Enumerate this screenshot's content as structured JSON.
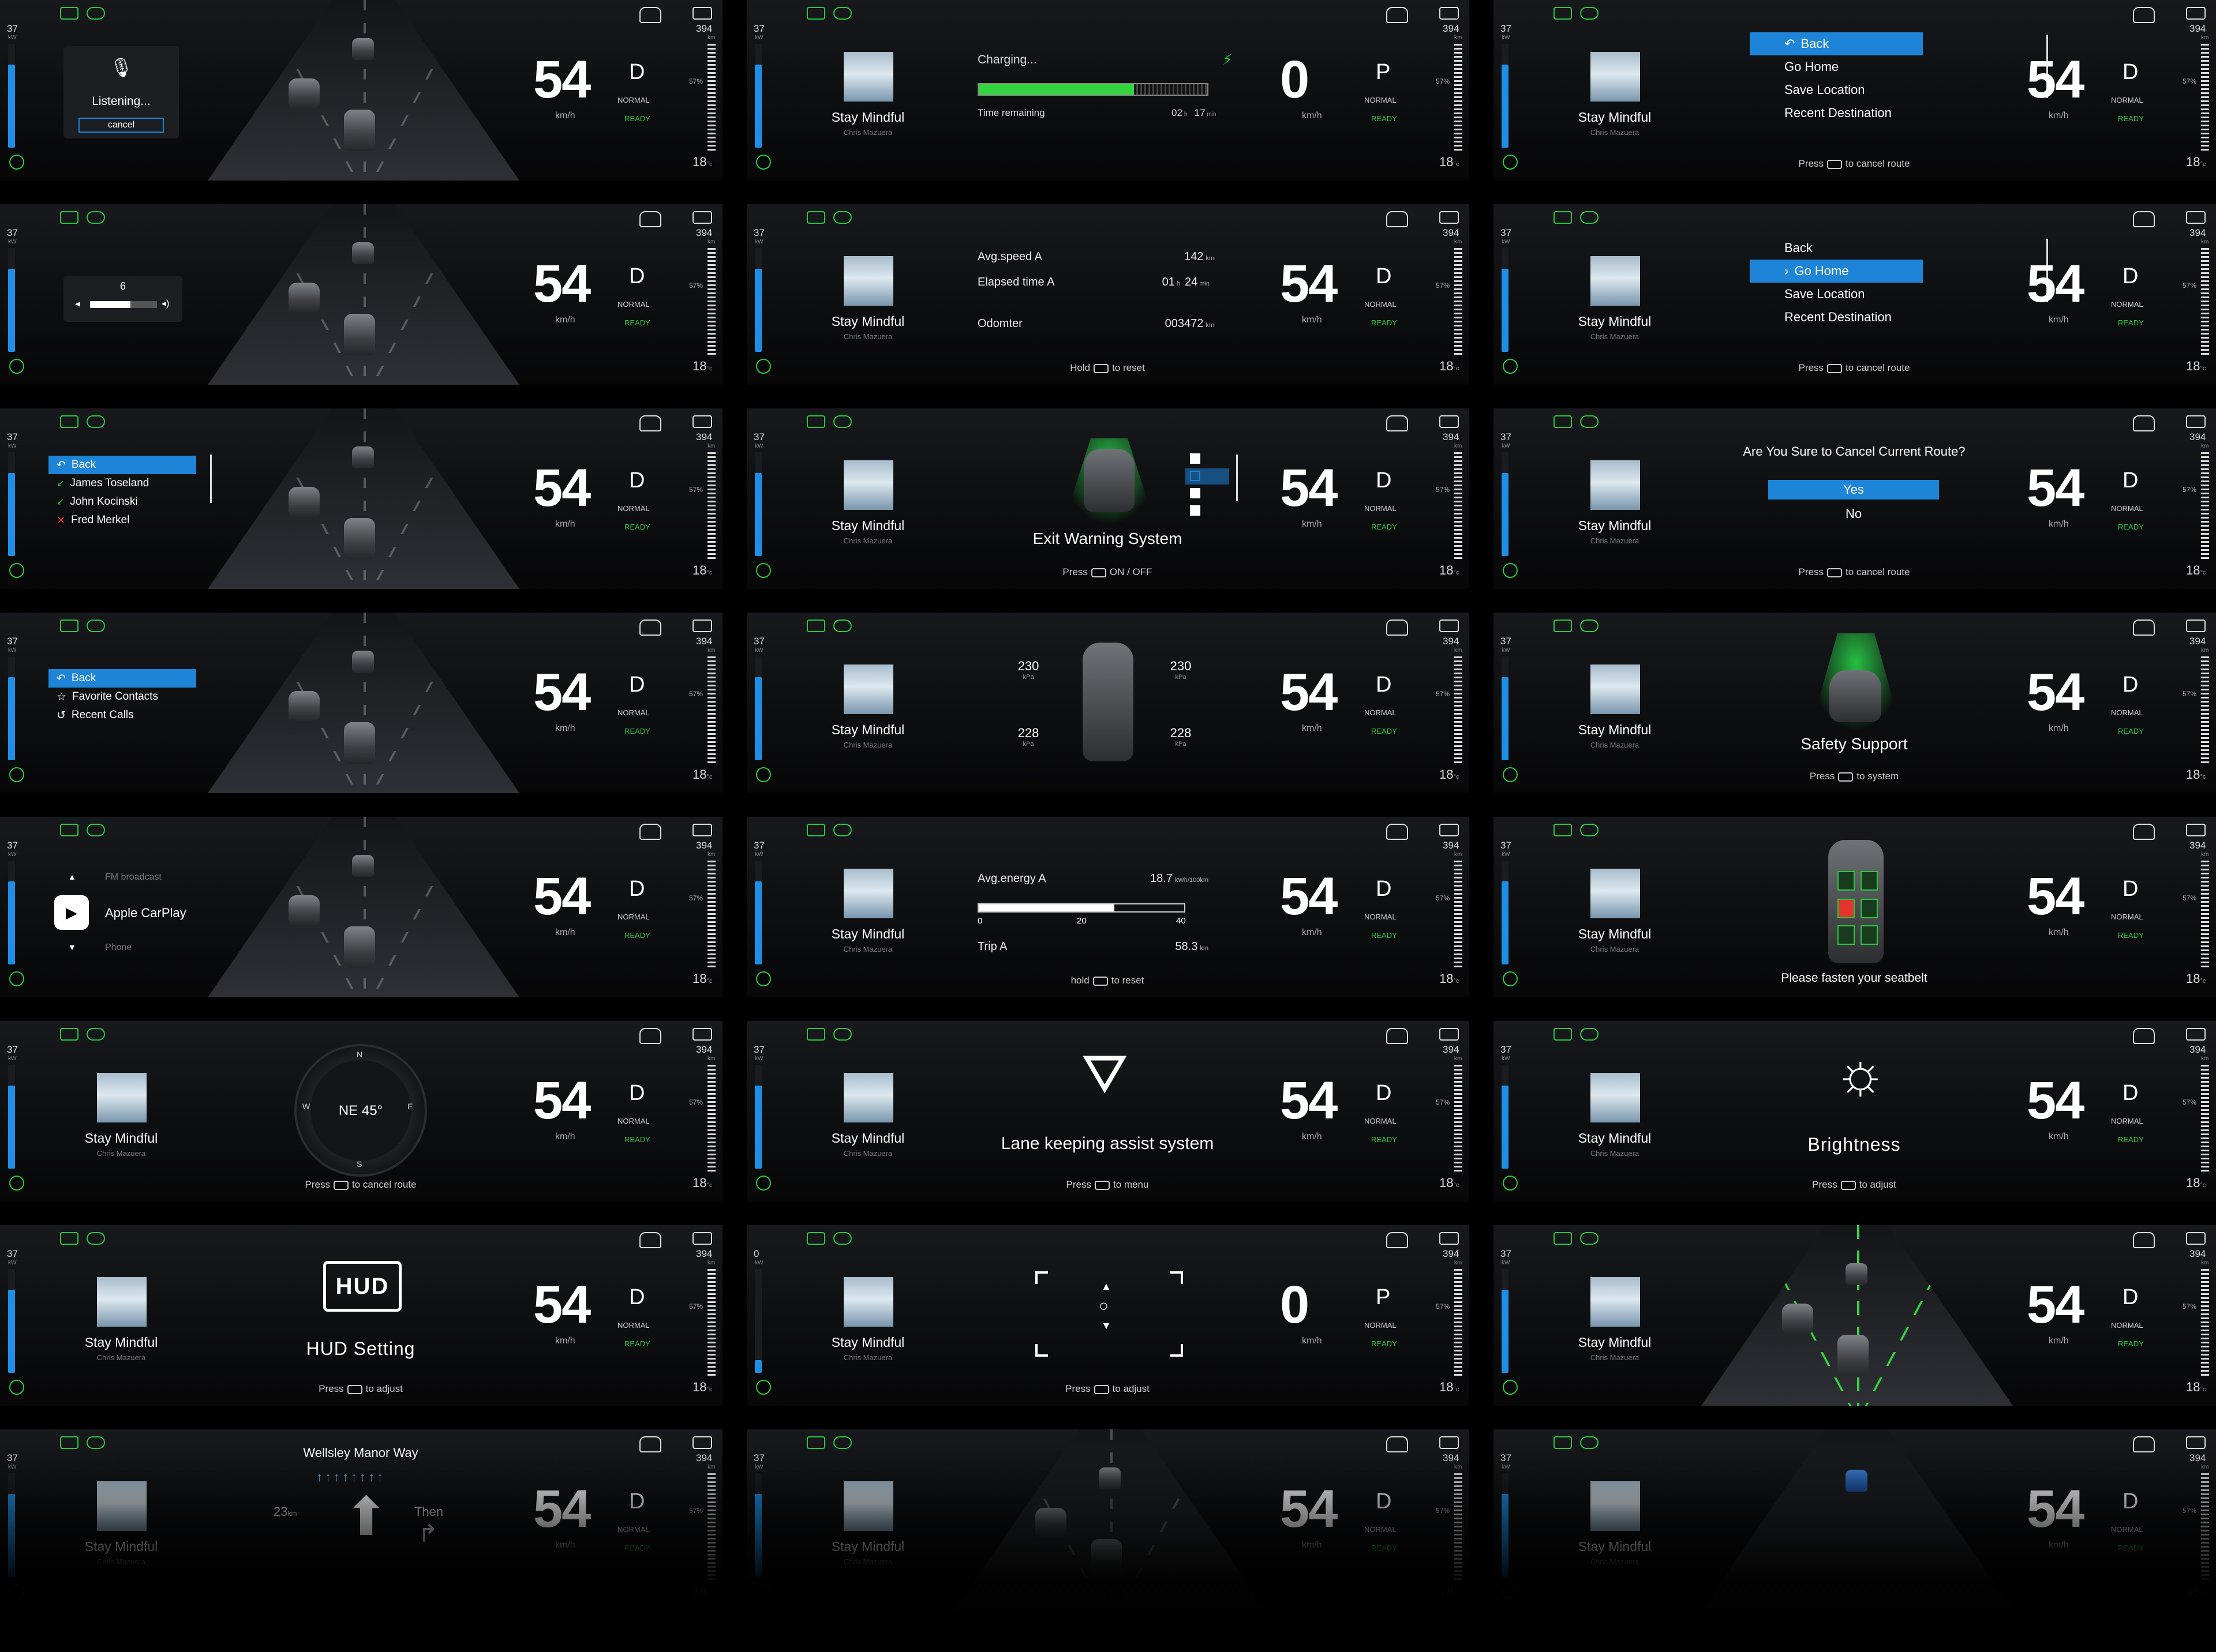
{
  "common": {
    "power_value": "37",
    "power_unit": "kW",
    "range_value": "394",
    "range_unit": "km",
    "battery_percent": "57%",
    "temperature": "18",
    "temperature_unit": "°c",
    "speed_unit": "km/h",
    "drive_mode": "NORMAL",
    "ready_label": "READY",
    "media_title": "Stay Mindful",
    "media_artist": "Chris Mazuera",
    "accent_blue": "#1d84d8",
    "accent_green": "#28c840"
  },
  "panels": {
    "voice": {
      "speed": "54",
      "gear": "D",
      "title": "Listening...",
      "cancel": "cancel"
    },
    "charging": {
      "speed": "0",
      "gear": "P",
      "title": "Charging...",
      "time_label": "Time remaining",
      "hours": "02",
      "hours_unit": "h",
      "minutes": "17",
      "minutes_unit": "min",
      "progress": 0.68
    },
    "nav_back": {
      "speed": "54",
      "gear": "D",
      "items": [
        "Back",
        "Go Home",
        "Save Location",
        "Recent Destination"
      ],
      "hint_pre": "Press",
      "hint_post": "to cancel route"
    },
    "volume": {
      "speed": "54",
      "gear": "D",
      "level": "6",
      "fraction": 0.6
    },
    "trip": {
      "speed": "54",
      "gear": "D",
      "row1_label": "Avg.speed A",
      "row1_value": "142",
      "row1_unit": "km",
      "row2_label": "Elapsed time A",
      "row2_hours": "01",
      "row2_hours_unit": "h",
      "row2_minutes": "24",
      "row2_minutes_unit": "min",
      "row3_label": "Odomter",
      "row3_value": "003472",
      "row3_unit": "km",
      "hint_pre": "Hold",
      "hint_post": "to reset"
    },
    "nav_home": {
      "speed": "54",
      "gear": "D",
      "items": [
        "Back",
        "Go Home",
        "Save Location",
        "Recent Destination"
      ],
      "hint_pre": "Press",
      "hint_post": "to cancel route"
    },
    "calls": {
      "speed": "54",
      "gear": "D",
      "items": [
        "Back",
        "James Toseland",
        "John Kocinski",
        "Fred Merkel"
      ]
    },
    "exit_warning": {
      "speed": "54",
      "gear": "D",
      "title": "Exit Warning System",
      "hint_pre": "Press",
      "hint_post": "ON / OFF"
    },
    "cancel_route": {
      "speed": "54",
      "gear": "D",
      "question": "Are You Sure to Cancel Current Route?",
      "yes": "Yes",
      "no": "No",
      "hint_pre": "Press",
      "hint_post": "to cancel route"
    },
    "phone_menu": {
      "speed": "54",
      "gear": "D",
      "items": [
        "Back",
        "Favorite Contacts",
        "Recent Calls"
      ]
    },
    "tpms": {
      "speed": "54",
      "gear": "D",
      "fl": "230",
      "fr": "230",
      "rl": "228",
      "rr": "228",
      "unit": "kPa"
    },
    "safety": {
      "speed": "54",
      "gear": "D",
      "title": "Safety Support",
      "hint_pre": "Press",
      "hint_post": "to system"
    },
    "carplay": {
      "speed": "54",
      "gear": "D",
      "prev": "FM broadcast",
      "current": "Apple CarPlay",
      "next": "Phone"
    },
    "energy": {
      "speed": "54",
      "gear": "D",
      "row1_label": "Avg.energy A",
      "row1_value": "18.7",
      "row1_unit": "kWh/100km",
      "scale": [
        "0",
        "20",
        "40"
      ],
      "fraction": 0.66,
      "row2_label": "Trip A",
      "row2_value": "58.3",
      "row2_unit": "km",
      "hint_pre": "hold",
      "hint_post": "to reset"
    },
    "seatbelt": {
      "speed": "54",
      "gear": "D",
      "message": "Please fasten your seatbelt"
    },
    "compass": {
      "speed": "54",
      "gear": "D",
      "heading": "NE 45°",
      "n": "N",
      "e": "E",
      "s": "S",
      "w": "W",
      "hint_pre": "Press",
      "hint_post": "to cancel route"
    },
    "lane_keep": {
      "speed": "54",
      "gear": "D",
      "title": "Lane keeping assist system",
      "hint_pre": "Press",
      "hint_post": "to menu"
    },
    "brightness": {
      "speed": "54",
      "gear": "D",
      "title": "Brightness",
      "hint_pre": "Press",
      "hint_post": "to adjust"
    },
    "hud": {
      "speed": "54",
      "gear": "D",
      "icon_text": "HUD",
      "title": "HUD Setting",
      "hint_pre": "Press",
      "hint_post": "to adjust"
    },
    "hud_adjust": {
      "speed": "0",
      "gear": "P",
      "power_value": "0",
      "hint_pre": "Press",
      "hint_post": "to adjust"
    },
    "lane_view": {
      "speed": "54",
      "gear": "D"
    },
    "navigation": {
      "speed": "54",
      "gear": "D",
      "street": "Wellsley Manor Way",
      "distance": "23",
      "distance_unit": "km",
      "then": "Then"
    },
    "adas_view": {
      "speed": "54",
      "gear": "D"
    },
    "adas_view2": {
      "speed": "54",
      "gear": "D"
    }
  }
}
